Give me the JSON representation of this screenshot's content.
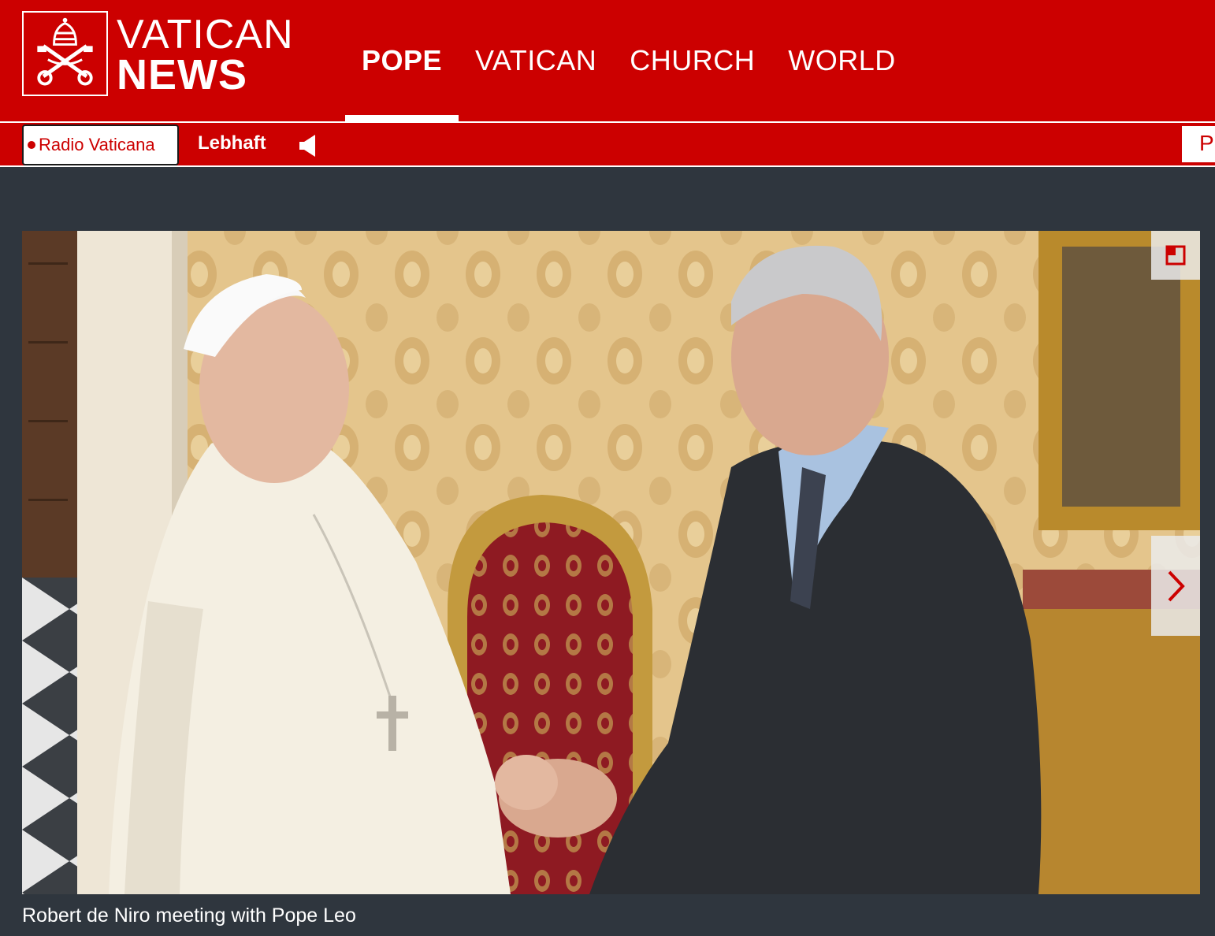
{
  "brand": {
    "line1": "VATICAN",
    "line2": "NEWS",
    "logo_icon": "papal-keys-icon"
  },
  "nav": {
    "items": [
      "POPE",
      "VATICAN",
      "CHURCH",
      "WORLD"
    ],
    "active": "POPE"
  },
  "radio": {
    "button_label": "Radio Vaticana",
    "live_label": "Lebhaft",
    "speaker_icon": "speaker-icon",
    "right_tab_label": "P"
  },
  "photo": {
    "expand_icon": "expand-icon",
    "next_icon": "chevron-right-icon",
    "caption": "Robert de Niro meeting with Pope Leo"
  },
  "colors": {
    "brand_red": "#cc0000",
    "page_background": "#2f363e",
    "text_white": "#ffffff"
  }
}
